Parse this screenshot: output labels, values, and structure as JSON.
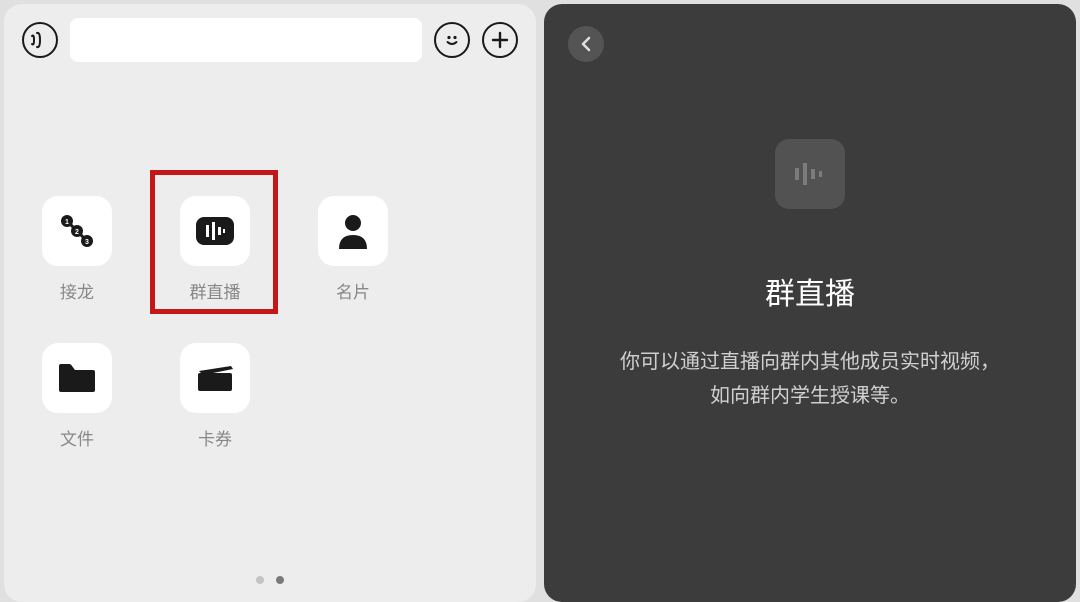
{
  "left": {
    "grid": [
      {
        "id": "chain",
        "label": "接龙"
      },
      {
        "id": "live",
        "label": "群直播"
      },
      {
        "id": "contact",
        "label": "名片"
      },
      {
        "id": "file",
        "label": "文件"
      },
      {
        "id": "coupon",
        "label": "卡券"
      }
    ]
  },
  "right": {
    "title": "群直播",
    "desc_line1": "你可以通过直播向群内其他成员实时视频，",
    "desc_line2": "如向群内学生授课等。"
  }
}
